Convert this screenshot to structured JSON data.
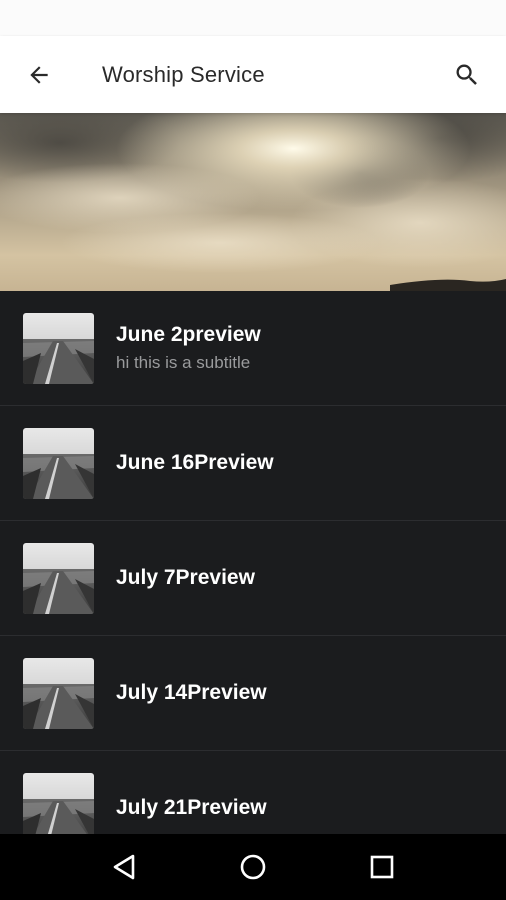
{
  "header": {
    "title": "Worship Service",
    "back_icon": "arrow-back-icon",
    "search_icon": "search-icon"
  },
  "hero": {
    "image": "sky-clouds-banner"
  },
  "list": {
    "items": [
      {
        "title": "June 2preview",
        "subtitle": "hi this is a subtitle",
        "thumbnail": "road-thumbnail"
      },
      {
        "title": "June 16Preview",
        "subtitle": "",
        "thumbnail": "road-thumbnail"
      },
      {
        "title": "July 7Preview",
        "subtitle": "",
        "thumbnail": "road-thumbnail"
      },
      {
        "title": "July 14Preview",
        "subtitle": "",
        "thumbnail": "road-thumbnail"
      },
      {
        "title": "July 21Preview",
        "subtitle": "",
        "thumbnail": "road-thumbnail"
      }
    ]
  },
  "nav": {
    "back": "nav-back-icon",
    "home": "nav-home-icon",
    "recents": "nav-recents-icon"
  },
  "colors": {
    "app_bar": "#ffffff",
    "list_background": "#1b1c1e",
    "title_text": "#ffffff",
    "subtitle_text": "#9a9b9d",
    "nav_bar": "#000000"
  }
}
